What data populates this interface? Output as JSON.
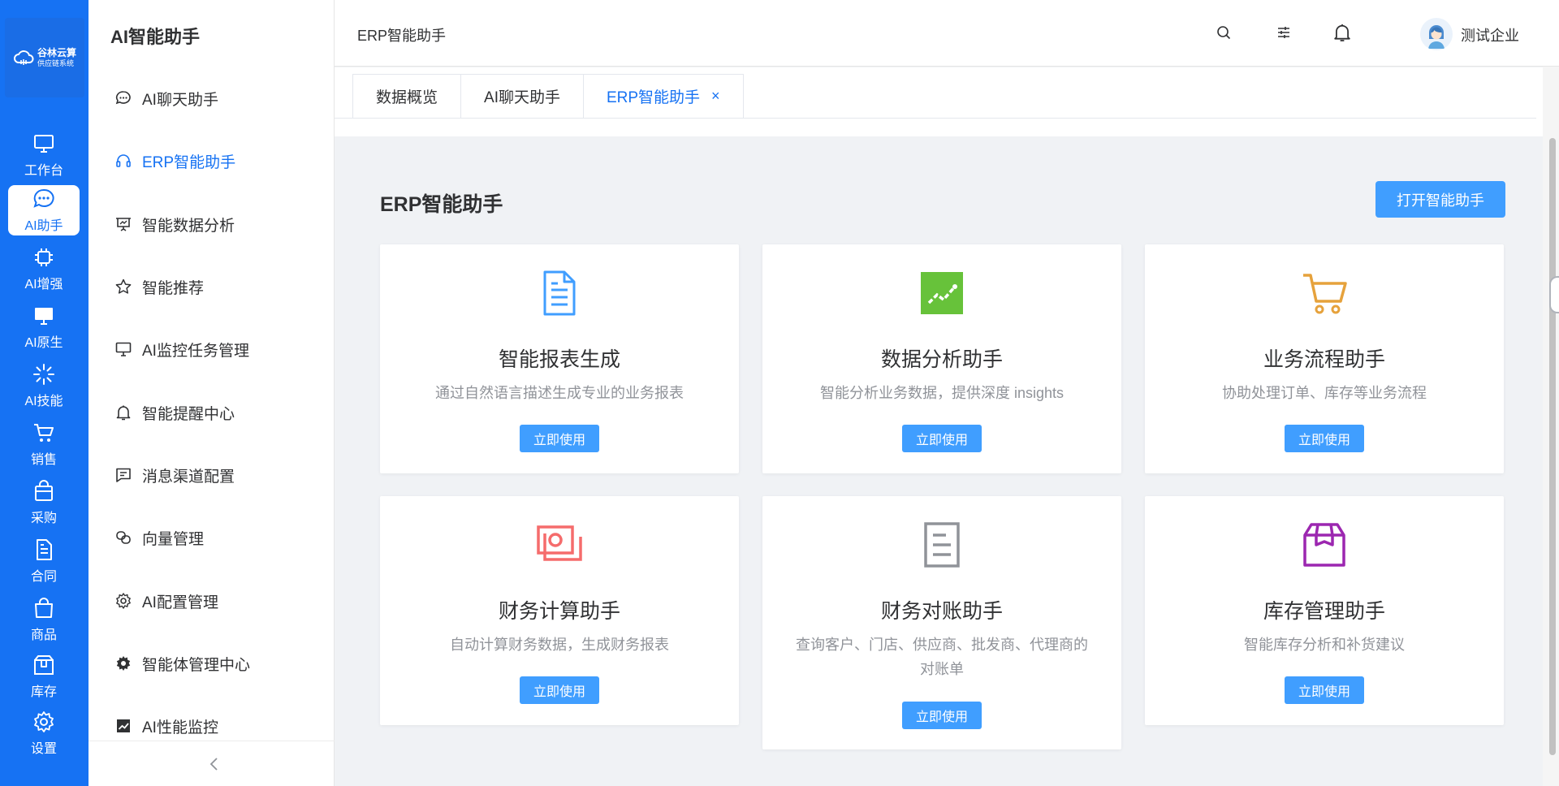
{
  "brand": {
    "line1": "谷林云算",
    "line2": "供应链系统",
    "color": "#1672f3"
  },
  "rail": [
    {
      "label": "工作台",
      "icon": "monitor-icon"
    },
    {
      "label": "AI助手",
      "icon": "chat-bubble-icon",
      "active": true
    },
    {
      "label": "AI增强",
      "icon": "chip-icon"
    },
    {
      "label": "AI原生",
      "icon": "desktop-icon"
    },
    {
      "label": "AI技能",
      "icon": "sparkle-icon"
    },
    {
      "label": "销售",
      "icon": "cart-icon"
    },
    {
      "label": "采购",
      "icon": "bag-icon"
    },
    {
      "label": "合同",
      "icon": "document-icon"
    },
    {
      "label": "商品",
      "icon": "shopping-bag-icon"
    },
    {
      "label": "库存",
      "icon": "box-icon"
    },
    {
      "label": "设置",
      "icon": "gear-icon"
    }
  ],
  "sidebar": {
    "title": "AI智能助手",
    "items": [
      {
        "label": "AI聊天助手",
        "icon": "chat-bubble-icon"
      },
      {
        "label": "ERP智能助手",
        "icon": "headset-icon",
        "active": true
      },
      {
        "label": "智能数据分析",
        "icon": "presentation-icon"
      },
      {
        "label": "智能推荐",
        "icon": "star-icon"
      },
      {
        "label": "AI监控任务管理",
        "icon": "monitor-icon"
      },
      {
        "label": "智能提醒中心",
        "icon": "bell-icon"
      },
      {
        "label": "消息渠道配置",
        "icon": "message-icon"
      },
      {
        "label": "向量管理",
        "icon": "layers-icon"
      },
      {
        "label": "AI配置管理",
        "icon": "gear-icon"
      },
      {
        "label": "智能体管理中心",
        "icon": "cog-solid-icon"
      },
      {
        "label": "AI性能监控",
        "icon": "chart-icon"
      }
    ]
  },
  "header": {
    "title": "ERP智能助手",
    "user": "测试企业"
  },
  "tabs": [
    {
      "label": "数据概览"
    },
    {
      "label": "AI聊天助手"
    },
    {
      "label": "ERP智能助手",
      "active": true,
      "close": "×"
    }
  ],
  "main": {
    "title": "ERP智能助手",
    "open_button": "打开智能助手",
    "cards": [
      {
        "title": "智能报表生成",
        "desc": "通过自然语言描述生成专业的业务报表",
        "button": "立即使用",
        "icon": "file-text-icon",
        "color": "#409eff"
      },
      {
        "title": "数据分析助手",
        "desc": "智能分析业务数据，提供深度 insights",
        "button": "立即使用",
        "icon": "trend-chart-icon",
        "color": "#67c23a"
      },
      {
        "title": "业务流程助手",
        "desc": "协助处理订单、库存等业务流程",
        "button": "立即使用",
        "icon": "shopping-cart-icon",
        "color": "#e6a23c"
      },
      {
        "title": "财务计算助手",
        "desc": "自动计算财务数据，生成财务报表",
        "button": "立即使用",
        "icon": "money-icon",
        "color": "#f56c6c"
      },
      {
        "title": "财务对账助手",
        "desc": "查询客户、门店、供应商、批发商、代理商的对账单",
        "button": "立即使用",
        "icon": "tickets-icon",
        "color": "#909399"
      },
      {
        "title": "库存管理助手",
        "desc": "智能库存分析和补货建议",
        "button": "立即使用",
        "icon": "package-icon",
        "color": "#9c27b0"
      }
    ]
  }
}
